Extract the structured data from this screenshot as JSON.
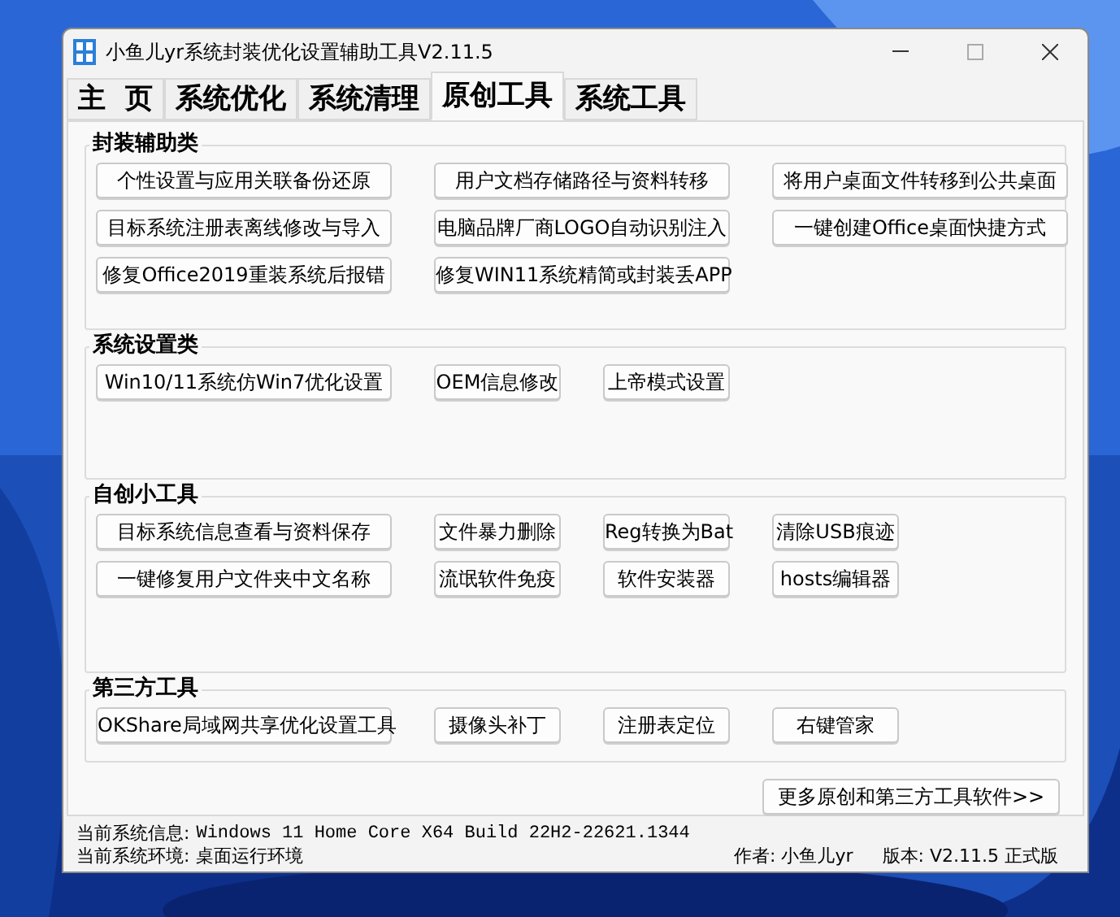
{
  "window": {
    "title": "小鱼儿yr系统封装优化设置辅助工具V2.11.5"
  },
  "tabs": [
    {
      "label": "主  页",
      "selected": false
    },
    {
      "label": "系统优化",
      "selected": false
    },
    {
      "label": "系统清理",
      "selected": false
    },
    {
      "label": "原创工具",
      "selected": true
    },
    {
      "label": "系统工具",
      "selected": false
    }
  ],
  "groups": [
    {
      "title": "封装辅助类",
      "rows": [
        [
          {
            "label": "个性设置与应用关联备份还原",
            "kind": "wide"
          },
          {
            "label": "用户文档存储路径与资料转移",
            "kind": "wide"
          },
          {
            "label": "将用户桌面文件转移到公共桌面",
            "kind": "wide"
          }
        ],
        [
          {
            "label": "目标系统注册表离线修改与导入",
            "kind": "wide"
          },
          {
            "label": "电脑品牌厂商LOGO自动识别注入",
            "kind": "wide"
          },
          {
            "label": "一键创建Office桌面快捷方式",
            "kind": "wide"
          }
        ],
        [
          {
            "label": "修复Office2019重装系统后报错",
            "kind": "wide"
          },
          {
            "label": "修复WIN11系统精简或封装丢APP",
            "kind": "wide"
          }
        ]
      ]
    },
    {
      "title": "系统设置类",
      "rows": [
        [
          {
            "label": "Win10/11系统仿Win7优化设置",
            "kind": "wide"
          },
          {
            "label": "OEM信息修改",
            "kind": "small"
          },
          {
            "label": "上帝模式设置",
            "kind": "small"
          }
        ]
      ]
    },
    {
      "title": "自创小工具",
      "rows": [
        [
          {
            "label": "目标系统信息查看与资料保存",
            "kind": "wide"
          },
          {
            "label": "文件暴力删除",
            "kind": "small"
          },
          {
            "label": "Reg转换为Bat",
            "kind": "small"
          },
          {
            "label": "清除USB痕迹",
            "kind": "small"
          }
        ],
        [
          {
            "label": "一键修复用户文件夹中文名称",
            "kind": "wide"
          },
          {
            "label": "流氓软件免疫",
            "kind": "small"
          },
          {
            "label": "软件安装器",
            "kind": "small"
          },
          {
            "label": "hosts编辑器",
            "kind": "small"
          }
        ]
      ]
    },
    {
      "title": "第三方工具",
      "rows": [
        [
          {
            "label": "OKShare局域网共享优化设置工具",
            "kind": "wide"
          },
          {
            "label": "摄像头补丁",
            "kind": "small"
          },
          {
            "label": "注册表定位",
            "kind": "small"
          },
          {
            "label": "右键管家",
            "kind": "small"
          }
        ]
      ]
    }
  ],
  "more_button": "更多原创和第三方工具软件>>",
  "status_bar": {
    "info_label": "当前系统信息:",
    "info_value": "Windows 11 Home Core X64 Build 22H2-22621.1344",
    "env_label": "当前系统环境:",
    "env_value": "桌面运行环境",
    "author": "作者: 小鱼儿yr",
    "version": "版本: V2.11.5 正式版"
  }
}
